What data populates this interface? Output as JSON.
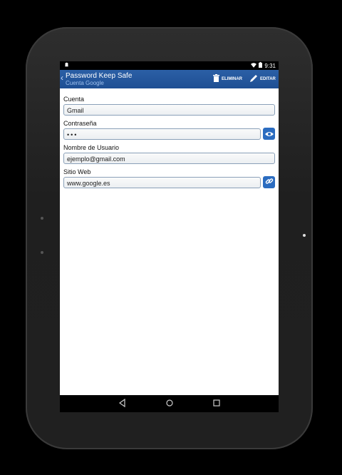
{
  "status": {
    "time": "9:31"
  },
  "appbar": {
    "title": "Password Keep Safe",
    "subtitle": "Cuenta Google",
    "delete_label": "ELIMINAR",
    "edit_label": "EDITAR"
  },
  "fields": {
    "cuenta": {
      "label": "Cuenta",
      "value": "Gmail"
    },
    "contrasena": {
      "label": "Contraseña",
      "value": "•••"
    },
    "usuario": {
      "label": "Nombre de Usuario",
      "value": "ejemplo@gmail.com"
    },
    "web": {
      "label": "Sitio Web",
      "value": "www.google.es"
    }
  },
  "icons": {
    "show_password": "eye-icon",
    "open_link": "link-icon",
    "delete": "trash-icon",
    "edit": "pencil-icon"
  },
  "colors": {
    "appbar": "#2b5fa6",
    "accent_button": "#2b6cc0"
  }
}
